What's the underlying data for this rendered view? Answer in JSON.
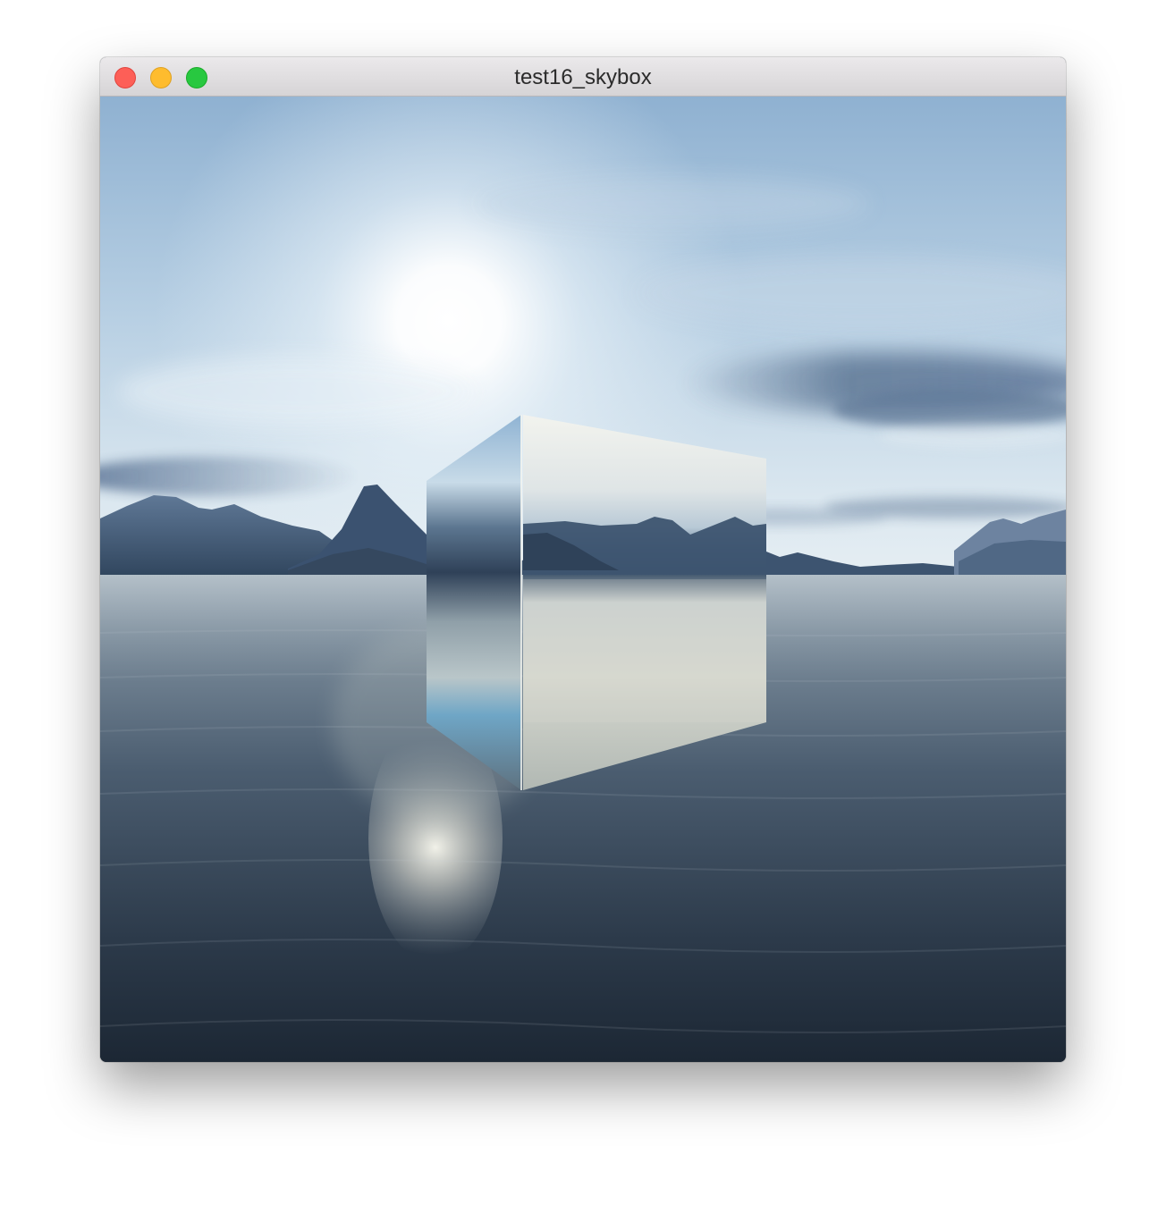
{
  "window": {
    "title": "test16_skybox",
    "buttons": [
      "close",
      "minimize",
      "maximize"
    ]
  },
  "scene": {
    "description_icon": "skybox-scene",
    "colors": {
      "sky_top": "#8fb0cf",
      "sun": "#ffffff",
      "horizon": "#d4e2ec",
      "water_far": "#7b8d9c",
      "water_near": "#1f2b38",
      "mountains": "#3f5874"
    }
  }
}
